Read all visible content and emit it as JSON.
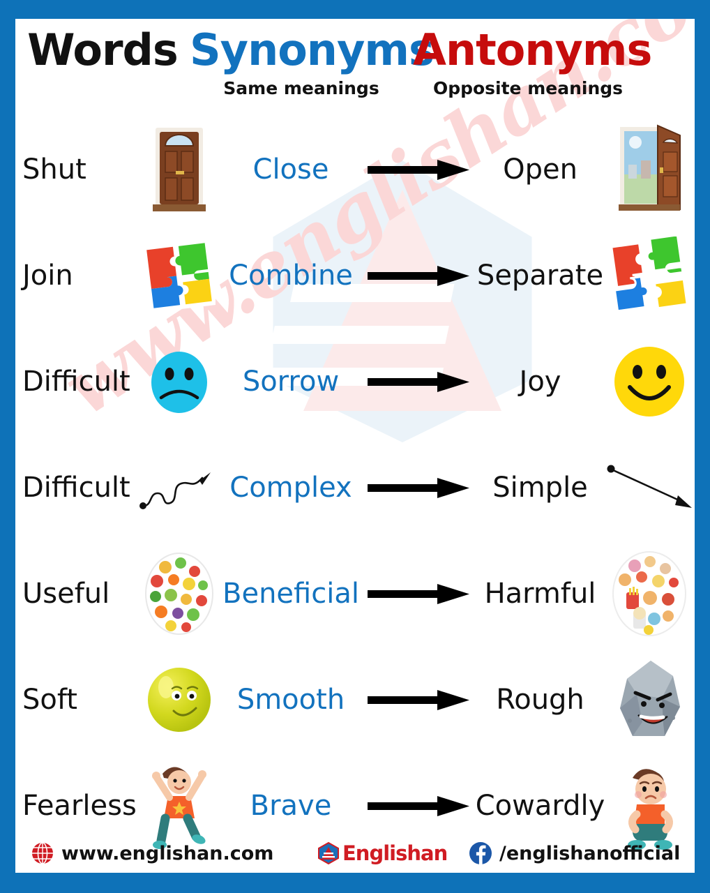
{
  "theme": {
    "border_color": "#0E72B8",
    "background": "#FFFFFF",
    "words_color": "#111111",
    "synonyms_color": "#1272BE",
    "antonyms_color": "#C60C0C",
    "watermark_color": "#FBD7D7"
  },
  "header": {
    "col_words": "Words",
    "col_synonyms": "Synonyms",
    "col_synonyms_sub": "Same meanings",
    "col_antonyms": "Antonyms",
    "col_antonyms_sub": "Opposite meanings"
  },
  "watermark": {
    "text": "www.englishan.com",
    "logo_name": "englishan-hexagon-pyramid-logo"
  },
  "rows": [
    {
      "word": "Shut",
      "synonym": "Close",
      "antonym": "Open",
      "left_icon": "closed-door-icon",
      "right_icon": "open-door-icon"
    },
    {
      "word": "Join",
      "synonym": "Combine",
      "antonym": "Separate",
      "left_icon": "joined-puzzle-icon",
      "right_icon": "separated-puzzle-icon"
    },
    {
      "word": "Difficult",
      "synonym": "Sorrow",
      "antonym": "Joy",
      "left_icon": "sad-face-icon",
      "right_icon": "happy-face-icon"
    },
    {
      "word": "Difficult",
      "synonym": "Complex",
      "antonym": "Simple",
      "left_icon": "squiggly-arrow-icon",
      "right_icon": "straight-arrow-icon"
    },
    {
      "word": "Useful",
      "synonym": "Beneficial",
      "antonym": "Harmful",
      "left_icon": "healthy-food-plate-icon",
      "right_icon": "junk-food-plate-icon"
    },
    {
      "word": "Soft",
      "synonym": "Smooth",
      "antonym": "Rough",
      "left_icon": "smooth-ball-face-icon",
      "right_icon": "rough-rock-face-icon"
    },
    {
      "word": "Fearless",
      "synonym": "Brave",
      "antonym": "Cowardly",
      "left_icon": "brave-boy-icon",
      "right_icon": "scared-boy-icon"
    }
  ],
  "footer": {
    "website": "www.englishan.com",
    "website_icon": "globe-icon",
    "brand": "Englishan",
    "brand_icon": "englishan-logo-icon",
    "facebook": "/englishanofficial",
    "facebook_icon": "facebook-icon"
  }
}
